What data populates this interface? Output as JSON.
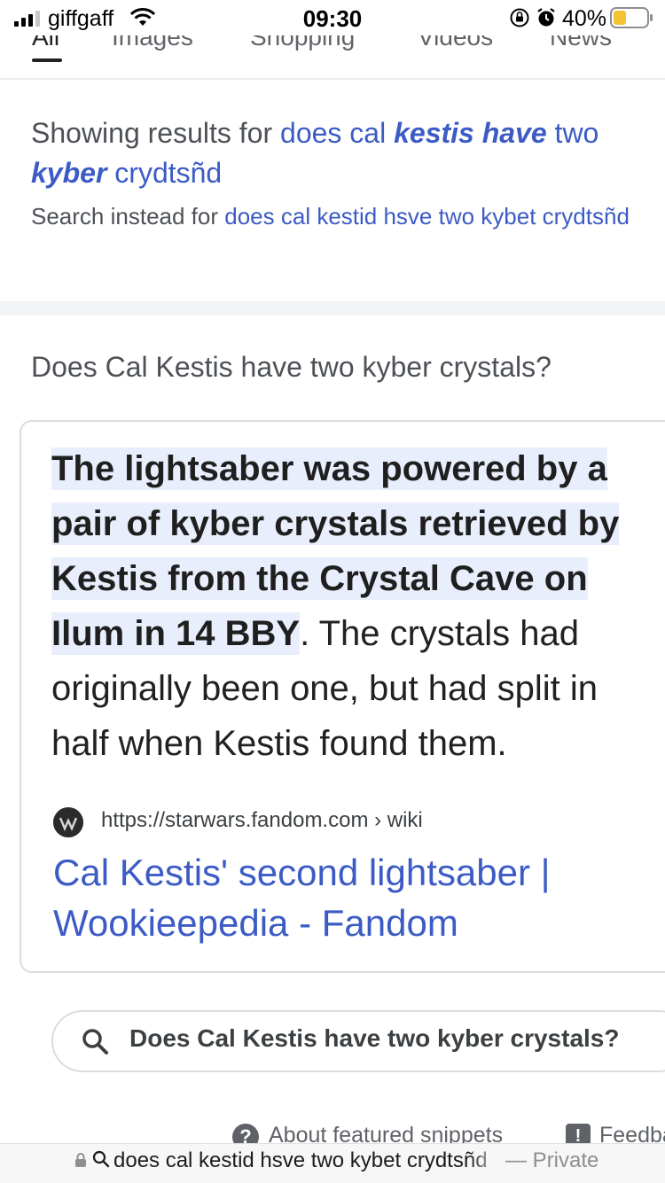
{
  "status_bar": {
    "carrier": "giffgaff",
    "time": "09:30",
    "battery": "40%"
  },
  "tabs": [
    "All",
    "Images",
    "Shopping",
    "Videos",
    "News"
  ],
  "spelling": {
    "showing_prefix": "Showing results for",
    "corrected_a": "does cal ",
    "corrected_b": "kestis have",
    "corrected_c": " two",
    "corrected_d": "kyber",
    "corrected_e": " crydtsñd",
    "instead_prefix": "Search instead for",
    "original_query": "does cal kestid hsve two kybet crydtsñd"
  },
  "featured_snippet": {
    "question": "Does Cal Kestis have two kyber crystals?",
    "highlight": "The lightsaber was powered by a pair of kyber crystals retrieved by Kestis from the Crystal Cave on Ilum in 14 BBY",
    "rest": ". The crystals had originally been one, but had split in half when Kestis found them.",
    "source_url": "https://starwars.fandom.com › wiki",
    "source_title": "Cal Kestis' second lightsaber | Wookieepedia - Fandom"
  },
  "related_search": "Does Cal Kestis have two kyber crystals?",
  "footer": {
    "about": "About featured snippets",
    "feedback": "Feedback"
  },
  "address_bar": {
    "query": "does cal kestid hsve two kybet crydtsñd",
    "mode": "— Private"
  },
  "colors": {
    "link": "#3c5bc5",
    "highlight_bg": "#e8eefb",
    "battery_fill": "#f4c430"
  }
}
